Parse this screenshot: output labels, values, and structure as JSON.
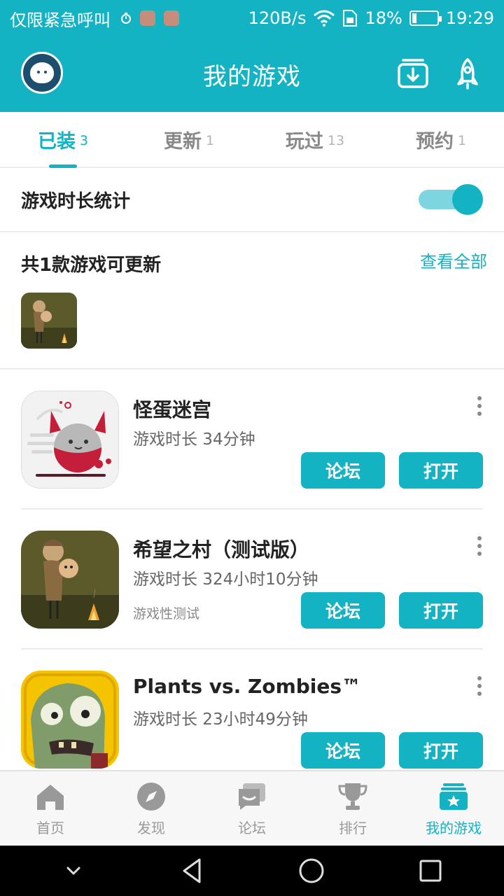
{
  "status_bar": {
    "carrier": "仅限紧急呼叫",
    "speed": "120B/s",
    "battery": "18%",
    "battery_level": 0.18,
    "time": "19:29"
  },
  "header": {
    "title": "我的游戏"
  },
  "tabs": [
    {
      "label": "已装",
      "count": "3",
      "active": true
    },
    {
      "label": "更新",
      "count": "1",
      "active": false
    },
    {
      "label": "玩过",
      "count": "13",
      "active": false
    },
    {
      "label": "预约",
      "count": "1",
      "active": false
    }
  ],
  "stats": {
    "label": "游戏时长统计",
    "enabled": true
  },
  "updates": {
    "heading": "共1款游戏可更新",
    "view_all": "查看全部"
  },
  "games": [
    {
      "name": "怪蛋迷宫",
      "playtime": "游戏时长 34分钟",
      "tag": "",
      "forum_label": "论坛",
      "open_label": "打开"
    },
    {
      "name": "希望之村（测试版）",
      "playtime": "游戏时长 324小时10分钟",
      "tag": "游戏性测试",
      "forum_label": "论坛",
      "open_label": "打开"
    },
    {
      "name": "Plants vs. Zombies™",
      "playtime": "游戏时长 23小时49分钟",
      "tag": "",
      "forum_label": "论坛",
      "open_label": "打开"
    }
  ],
  "bottom_nav": [
    {
      "label": "首页",
      "icon": "home-icon",
      "active": false
    },
    {
      "label": "发现",
      "icon": "compass-icon",
      "active": false
    },
    {
      "label": "论坛",
      "icon": "forum-icon",
      "active": false
    },
    {
      "label": "排行",
      "icon": "trophy-icon",
      "active": false
    },
    {
      "label": "我的游戏",
      "icon": "my-games-icon",
      "active": true
    }
  ],
  "colors": {
    "accent": "#13b3c4",
    "inactive": "#999999"
  }
}
